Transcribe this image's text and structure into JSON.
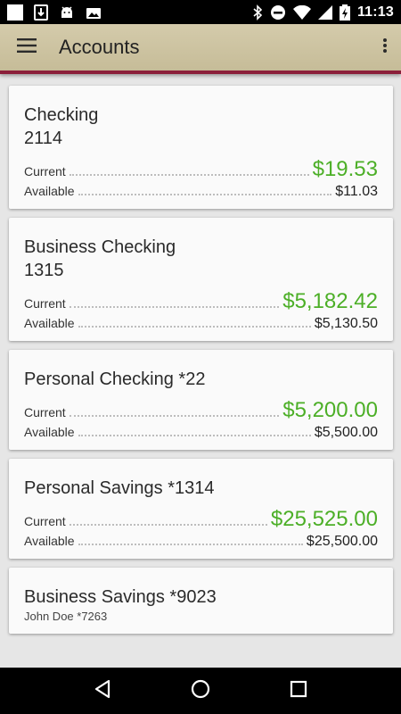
{
  "status_bar": {
    "time": "11:13",
    "left_icons": [
      "white-square-icon",
      "sim-card-icon",
      "android-icon",
      "photo-icon"
    ],
    "right_icons": [
      "bluetooth-icon",
      "do-not-disturb-icon",
      "wifi-icon",
      "signal-icon",
      "battery-charging-icon"
    ]
  },
  "app_bar": {
    "title": "Accounts",
    "accent_color": "#8b1f3a"
  },
  "accounts": [
    {
      "name": "Checking",
      "number": "2114",
      "current_label": "Current",
      "current": "$19.53",
      "available_label": "Available",
      "available": "$11.03"
    },
    {
      "name": "Business Checking",
      "number": "1315",
      "current_label": "Current",
      "current": "$5,182.42",
      "available_label": "Available",
      "available": "$5,130.50"
    },
    {
      "name": "Personal Checking *22",
      "current_label": "Current",
      "current": "$5,200.00",
      "available_label": "Available",
      "available": "$5,500.00"
    },
    {
      "name": "Personal Savings *1314",
      "current_label": "Current",
      "current": "$25,525.00",
      "available_label": "Available",
      "available": "$25,500.00"
    },
    {
      "name": "Business Savings *9023",
      "sub": "John Doe *7263"
    }
  ],
  "nav_bar": {
    "buttons": [
      "back-icon",
      "home-icon",
      "recents-icon"
    ]
  },
  "colors": {
    "positive": "#4caf27",
    "app_bar": "#c9bf9c"
  }
}
